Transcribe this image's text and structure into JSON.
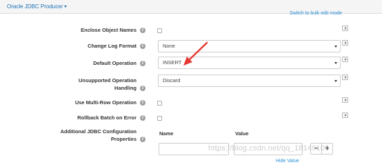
{
  "header": {
    "title": "Oracle JDBC Producer"
  },
  "bulk_edit_link": "Switch to bulk edit mode",
  "fields": {
    "enclose_object_names": {
      "label": "Enclose Object Names",
      "checked": false
    },
    "change_log_format": {
      "label": "Change Log Format",
      "value": "None"
    },
    "default_operation": {
      "label": "Default Operation",
      "value": "INSERT"
    },
    "unsupported_operation_handling": {
      "label_line1": "Unsupported Operation",
      "label_line2": "Handling",
      "value": "Discard"
    },
    "use_multi_row_operation": {
      "label": "Use Multi-Row Operation",
      "checked": false
    },
    "rollback_batch_on_error": {
      "label": "Rollback Batch on Error",
      "checked": false
    },
    "additional_properties": {
      "label_line1": "Additional JDBC Configuration",
      "label_line2": "Properties",
      "columns": [
        "Name",
        "Value"
      ],
      "name_value": "",
      "value_value": "",
      "remove_label": "−",
      "add_label": "+",
      "hide_value_link": "Hide Value"
    }
  },
  "watermark": "https://blog.csdn.net/qq_18149105",
  "colors": {
    "link": "#1a6fb5",
    "annotation_arrow": "#e53935"
  }
}
